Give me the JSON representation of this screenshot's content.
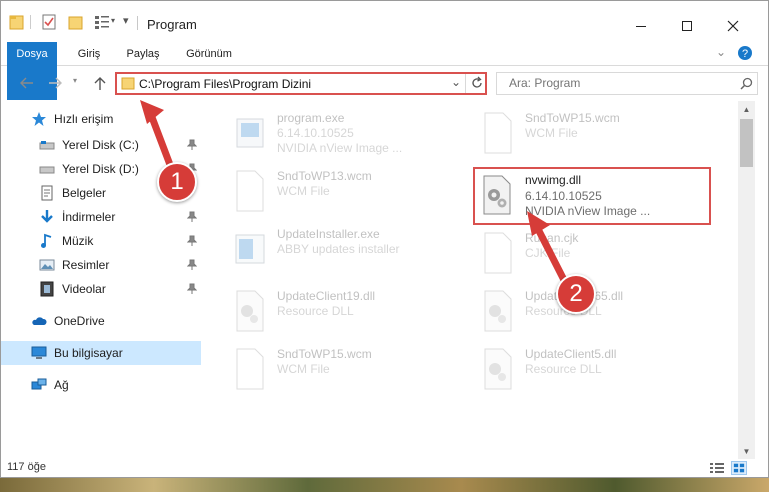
{
  "window": {
    "title": "Program",
    "minimize_icon": "minimize-icon",
    "maximize_icon": "maximize-icon",
    "close_icon": "close-icon"
  },
  "ribbon": {
    "tabs": [
      {
        "label": "Dosya"
      },
      {
        "label": "Giriş"
      },
      {
        "label": "Paylaş"
      },
      {
        "label": "Görünüm"
      }
    ]
  },
  "address": {
    "path": "C:\\Program Files\\Program Dizini"
  },
  "search": {
    "placeholder": "Ara: Program"
  },
  "navpane": {
    "quick_access": "Hızlı erişim",
    "items": [
      {
        "label": "Yerel Disk (C:)"
      },
      {
        "label": "Yerel Disk (D:)"
      },
      {
        "label": "Belgeler"
      },
      {
        "label": "İndirmeler"
      },
      {
        "label": "Müzik"
      },
      {
        "label": "Resimler"
      },
      {
        "label": "Videolar"
      }
    ],
    "onedrive": "OneDrive",
    "this_pc": "Bu bilgisayar",
    "network": "Ağ"
  },
  "files": [
    {
      "name": "program.exe",
      "version": "6.14.10.10525",
      "desc": "NVIDIA nView Image ..."
    },
    {
      "name": "SndToWP15.wcm",
      "version": "",
      "desc": "WCM File"
    },
    {
      "name": "SndToWP13.wcm",
      "version": "",
      "desc": "WCM File"
    },
    {
      "name": "nvwimg.dll",
      "version": "6.14.10.10525",
      "desc": "NVIDIA nView Image ..."
    },
    {
      "name": "UpdateInstaller.exe",
      "version": "",
      "desc": "ABBY updates installer"
    },
    {
      "name": "Runan.cjk",
      "version": "",
      "desc": "CJK File"
    },
    {
      "name": "UpdateClient19.dll",
      "version": "",
      "desc": "Resource DLL"
    },
    {
      "name": "UpdateClient65.dll",
      "version": "",
      "desc": "Resource DLL"
    },
    {
      "name": "SndToWP15.wcm",
      "version": "",
      "desc": "WCM File"
    },
    {
      "name": "UpdateClient5.dll",
      "version": "",
      "desc": "Resource DLL"
    }
  ],
  "status": {
    "count": "117 öğe"
  },
  "callouts": [
    "1",
    "2"
  ],
  "colors": {
    "accent": "#1979ca",
    "highlight_red": "#d9514f",
    "callout_red": "#d63c38",
    "selected_bg": "#cce8ff"
  }
}
